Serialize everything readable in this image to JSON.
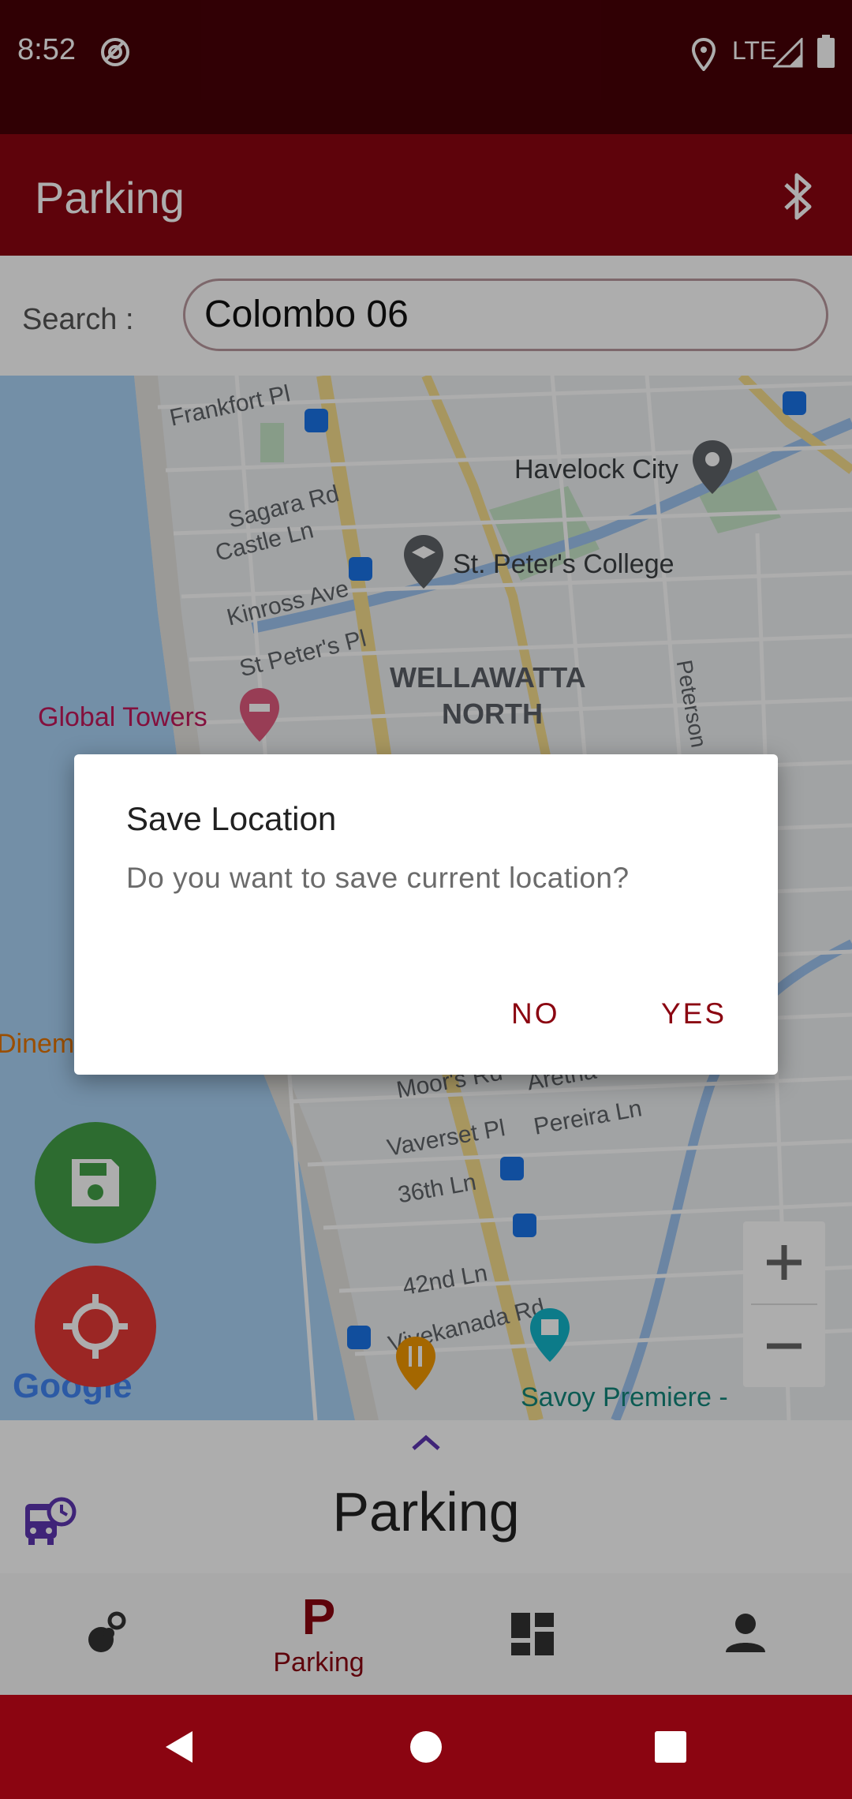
{
  "status": {
    "time": "8:52",
    "network": "LTE"
  },
  "app_bar": {
    "title": "Parking"
  },
  "search": {
    "label": "Search :",
    "value": "Colombo 06"
  },
  "map": {
    "streets": [
      "Frankfort Pl",
      "Sagara Rd",
      "Castle Ln",
      "Kinross Ave",
      "St Peter's Pl",
      "Peterson",
      "Moor's Rd",
      "Aretha",
      "Vaverset Pl",
      "Pereira Ln",
      "36th Ln",
      "42nd Ln",
      "Vivekanada Rd"
    ],
    "pois": {
      "havelock": "Havelock City",
      "st_peters": "St. Peter's College",
      "global_towers": "Global Towers",
      "cinema": "Dinem",
      "savoy": "Savoy Premiere -"
    },
    "neighborhood_line1": "WELLAWATTA",
    "neighborhood_line2": "NORTH",
    "attribution": "Google"
  },
  "dialog": {
    "title": "Save Location",
    "message": "Do you want to save current location?",
    "no_label": "NO",
    "yes_label": "YES"
  },
  "bottom_sheet": {
    "title": "Parking"
  },
  "bottom_nav": {
    "active_label": "Parking",
    "active_icon_letter": "P"
  },
  "colors": {
    "primary": "#8b0511",
    "status": "#480007",
    "save_fab": "#43a047",
    "locate_fab": "#e53935"
  }
}
